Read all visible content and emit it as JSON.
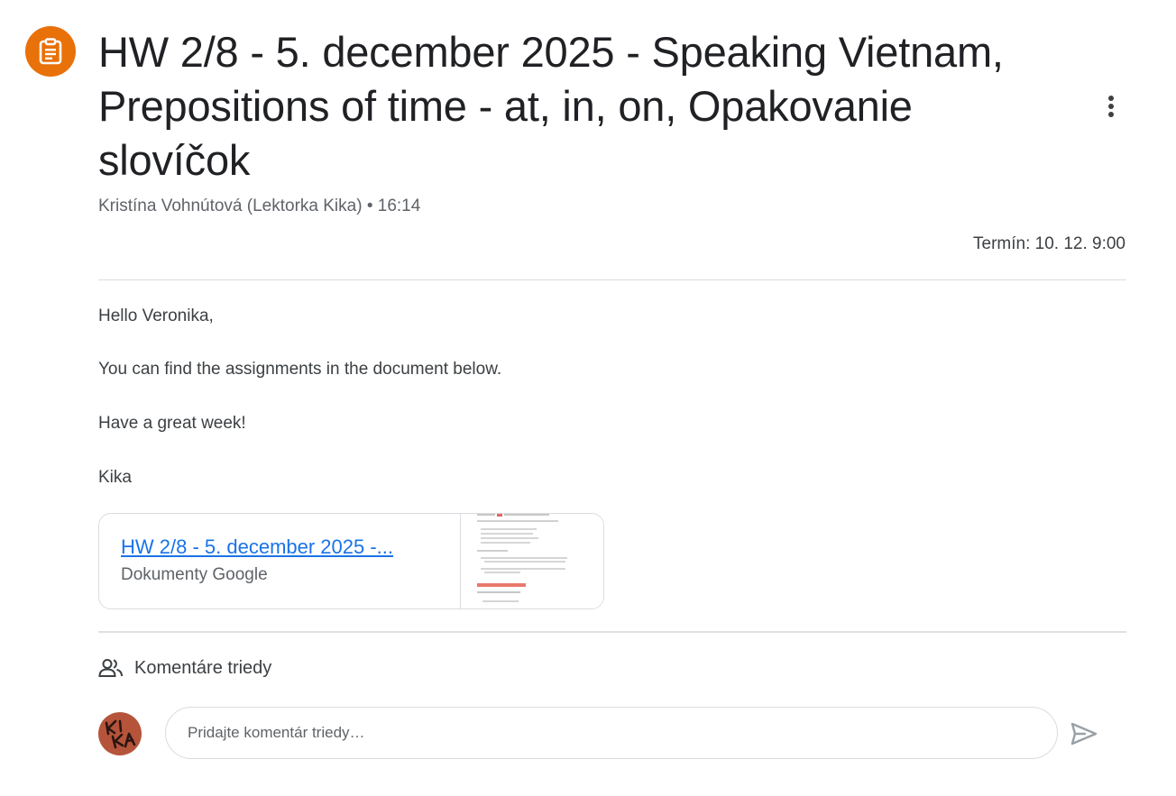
{
  "assignment": {
    "icon": "assignment-icon",
    "accent_color": "#e8710a",
    "title": "HW 2/8 - 5. december 2025 - Speaking Vietnam, Prepositions of time - at, in, on, Opakovanie slovíčok",
    "author": "Kristína Vohnútová (Lektorka Kika)",
    "separator": "•",
    "time": "16:14",
    "due": "Termín: 10. 12. 9:00"
  },
  "body": {
    "greeting": "Hello Veronika,",
    "line1": "You can find the assignments in the document below.",
    "line2": "Have a great week!",
    "signature": "Kika"
  },
  "attachment": {
    "title": "HW 2/8 - 5. december 2025 -...",
    "type": "Dokumenty Google",
    "link_color": "#1a73e8"
  },
  "comments": {
    "header": "Komentáre triedy",
    "header_icon": "people-icon",
    "placeholder": "Pridajte komentár triedy…",
    "avatar_text": "KIKA",
    "avatar_color": "#b5543b",
    "send_icon": "send-icon"
  }
}
